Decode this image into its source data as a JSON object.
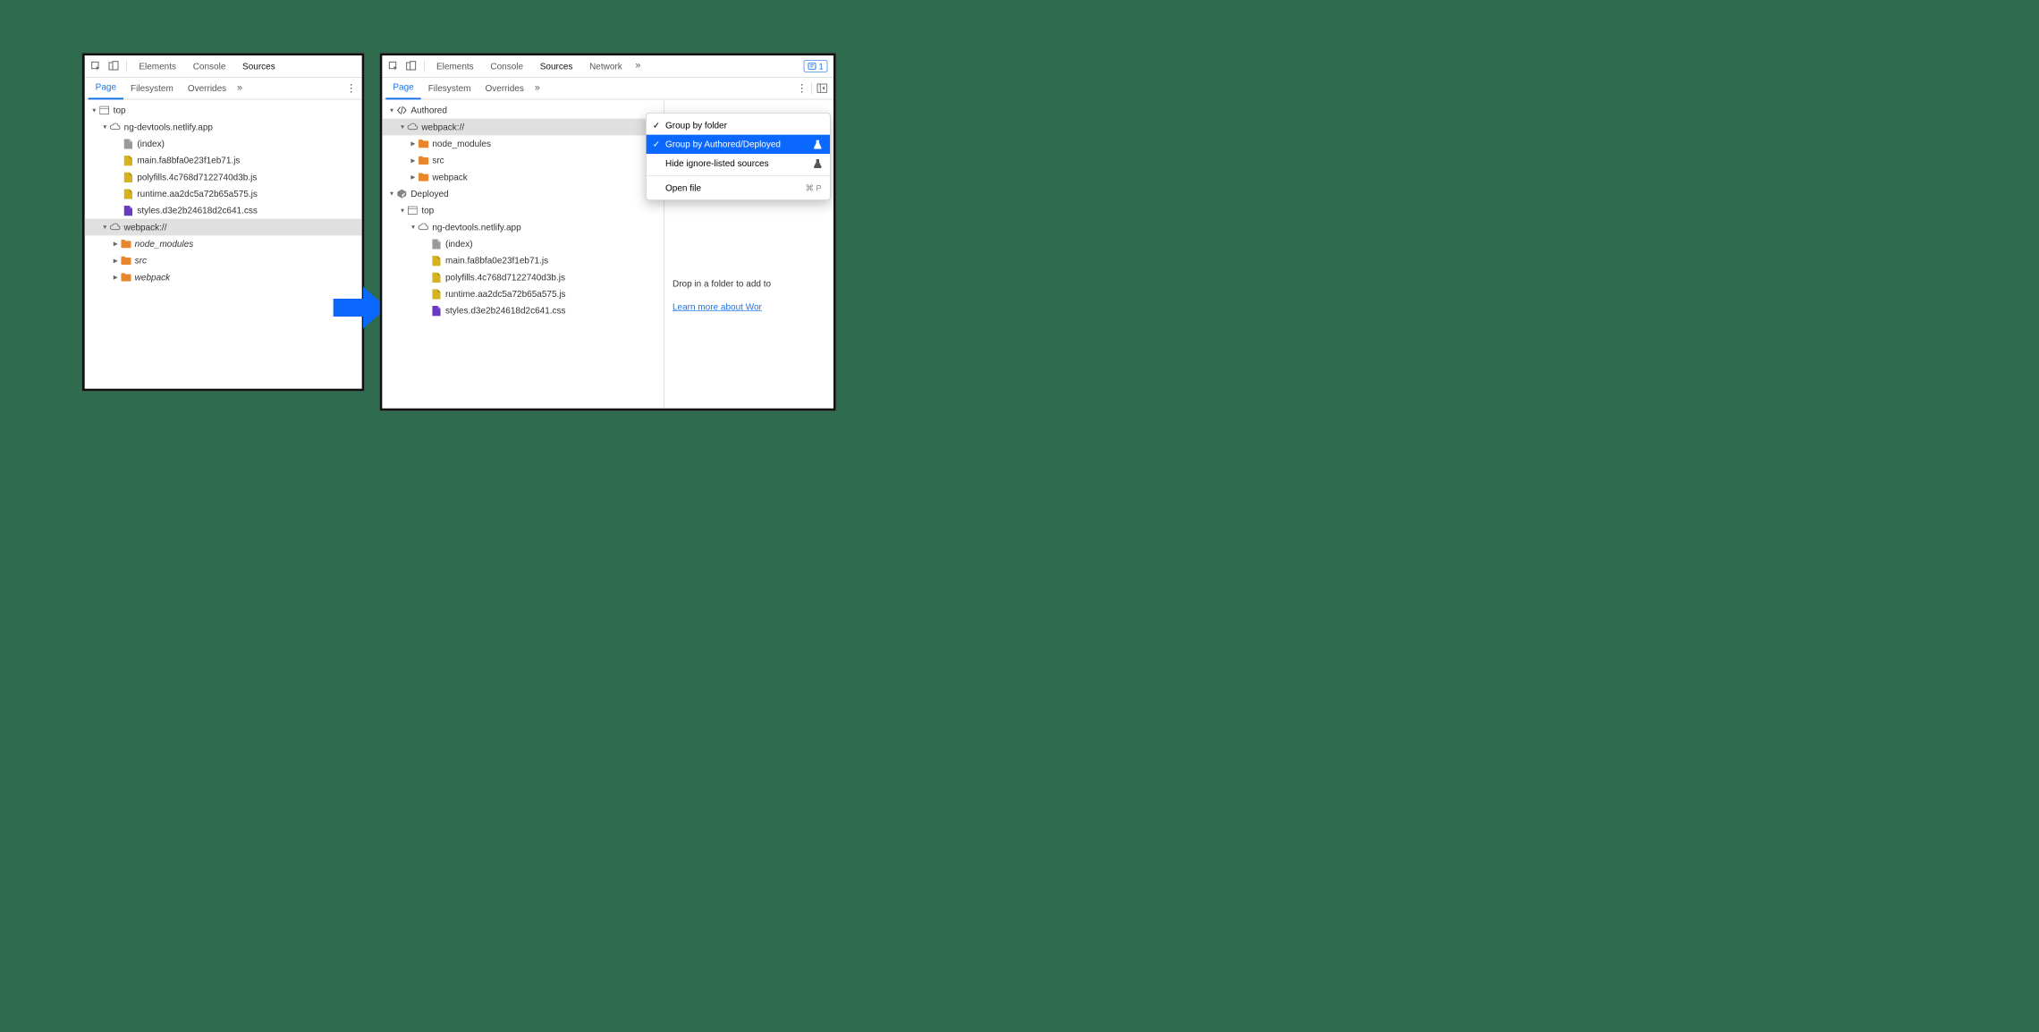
{
  "topTabs": {
    "elements": "Elements",
    "console": "Console",
    "sources": "Sources",
    "network": "Network"
  },
  "subTabs": {
    "page": "Page",
    "filesystem": "Filesystem",
    "overrides": "Overrides"
  },
  "issues": {
    "count": "1"
  },
  "treeLeft": {
    "top": "top",
    "domain": "ng-devtools.netlify.app",
    "index": "(index)",
    "main": "main.fa8bfa0e23f1eb71.js",
    "polyfills": "polyfills.4c768d7122740d3b.js",
    "runtime": "runtime.aa2dc5a72b65a575.js",
    "styles": "styles.d3e2b24618d2c641.css",
    "webpack": "webpack://",
    "node_modules": "node_modules",
    "src": "src",
    "webpackFolder": "webpack"
  },
  "treeRight": {
    "authored": "Authored",
    "webpack": "webpack://",
    "node_modules": "node_modules",
    "src": "src",
    "webpackFolder": "webpack",
    "deployed": "Deployed",
    "top": "top",
    "domain": "ng-devtools.netlify.app",
    "index": "(index)",
    "main": "main.fa8bfa0e23f1eb71.js",
    "polyfills": "polyfills.4c768d7122740d3b.js",
    "runtime": "runtime.aa2dc5a72b65a575.js",
    "styles": "styles.d3e2b24618d2c641.css"
  },
  "menu": {
    "groupByFolder": "Group by folder",
    "groupByAuthored": "Group by Authored/Deployed",
    "hideIgnore": "Hide ignore-listed sources",
    "openFile": "Open file",
    "shortcut": "⌘ P"
  },
  "dropArea": {
    "line1": "Drop in a folder to add to",
    "link": "Learn more about Wor"
  }
}
